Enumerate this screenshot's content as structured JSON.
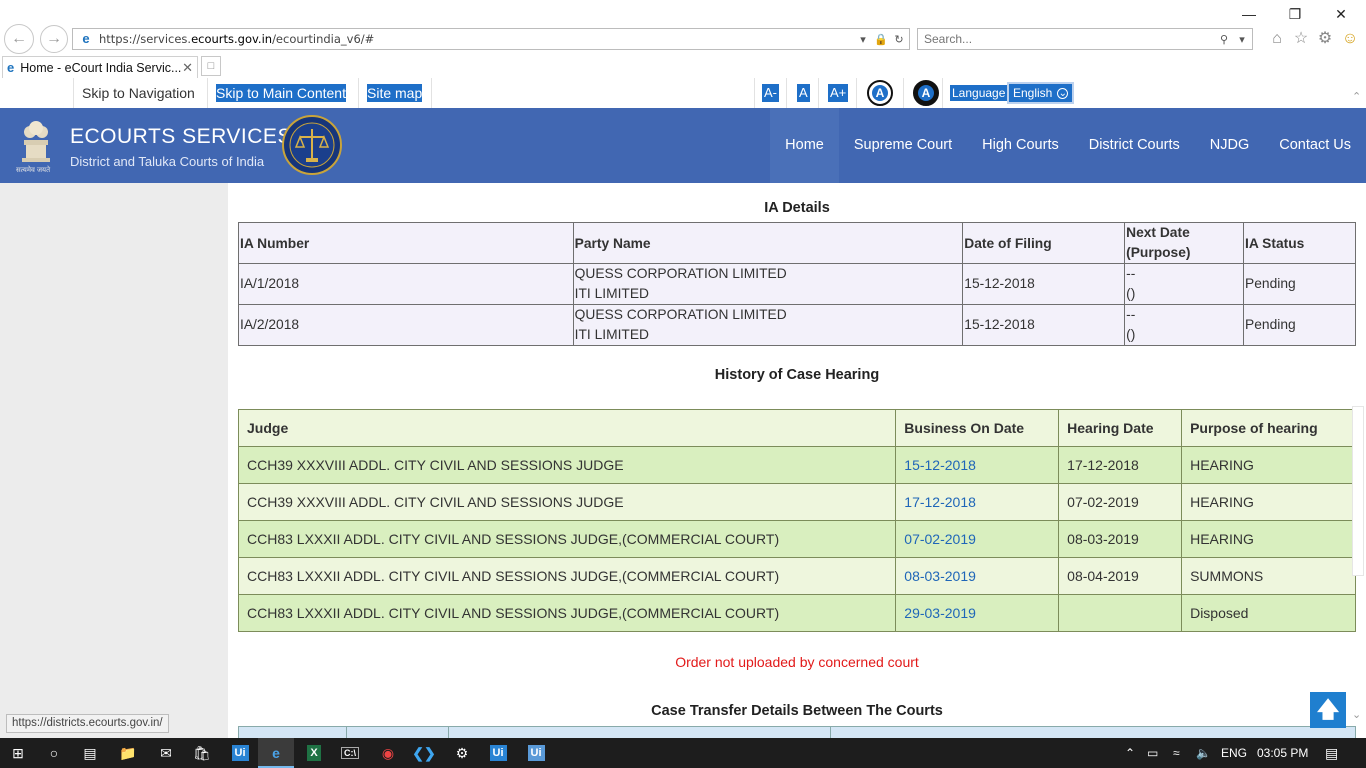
{
  "browser": {
    "address_prefix": "https://services.",
    "address_domain": "ecourts.gov.in",
    "address_path": "/ecourtindia_v6/#",
    "search_placeholder": "Search...",
    "tab_title": "Home - eCourt India Servic...",
    "status_url": "https://districts.ecourts.gov.in/"
  },
  "utility": {
    "skip_navigation": "Skip to Navigation",
    "skip_main": "Skip to Main Content",
    "site_map": "Site map",
    "font_decrease": "A-",
    "font_normal": "A",
    "font_increase": "A+",
    "contrast_1": "A",
    "contrast_2": "A",
    "language_label": "Language",
    "language_value": "English"
  },
  "header": {
    "title": "ECOURTS SERVICES",
    "subtitle": "District and Taluka Courts of India",
    "emblem_motto": "सत्यमेव जयते",
    "nav": [
      "Home",
      "Supreme Court",
      "High Courts",
      "District Courts",
      "NJDG",
      "Contact Us"
    ]
  },
  "ia_details": {
    "title": "IA Details",
    "columns": [
      "IA Number",
      "Party Name",
      "Date of Filing",
      "Next Date (Purpose)",
      "IA Status"
    ],
    "rows": [
      {
        "number": "IA/1/2018",
        "party_1": "QUESS CORPORATION LIMITED",
        "party_2": "ITI LIMITED",
        "filing": "15-12-2018",
        "next_1": "--",
        "next_2": "()",
        "status": "Pending"
      },
      {
        "number": "IA/2/2018",
        "party_1": "QUESS CORPORATION LIMITED",
        "party_2": "ITI LIMITED",
        "filing": "15-12-2018",
        "next_1": "--",
        "next_2": "()",
        "status": "Pending"
      }
    ]
  },
  "history": {
    "title": "History of Case Hearing",
    "columns": [
      "Judge",
      "Business On Date",
      "Hearing Date",
      "Purpose of hearing"
    ],
    "rows": [
      {
        "judge": "CCH39 XXXVIII ADDL. CITY CIVIL AND SESSIONS JUDGE",
        "business": "15-12-2018",
        "hearing": "17-12-2018",
        "purpose": "HEARING"
      },
      {
        "judge": "CCH39 XXXVIII ADDL. CITY CIVIL AND SESSIONS JUDGE",
        "business": "17-12-2018",
        "hearing": "07-02-2019",
        "purpose": "HEARING"
      },
      {
        "judge": "CCH83 LXXXII ADDL. CITY CIVIL AND SESSIONS JUDGE,(COMMERCIAL COURT)",
        "business": "07-02-2019",
        "hearing": "08-03-2019",
        "purpose": "HEARING"
      },
      {
        "judge": "CCH83 LXXXII ADDL. CITY CIVIL AND SESSIONS JUDGE,(COMMERCIAL COURT)",
        "business": "08-03-2019",
        "hearing": "08-04-2019",
        "purpose": "SUMMONS"
      },
      {
        "judge": "CCH83 LXXXII ADDL. CITY CIVIL AND SESSIONS JUDGE,(COMMERCIAL COURT)",
        "business": "29-03-2019",
        "hearing": "",
        "purpose": "Disposed"
      }
    ]
  },
  "order_note": "Order not uploaded by concerned court",
  "transfer": {
    "title": "Case Transfer Details Between The Courts"
  },
  "taskbar": {
    "lang": "ENG",
    "time": "03:05 PM"
  }
}
